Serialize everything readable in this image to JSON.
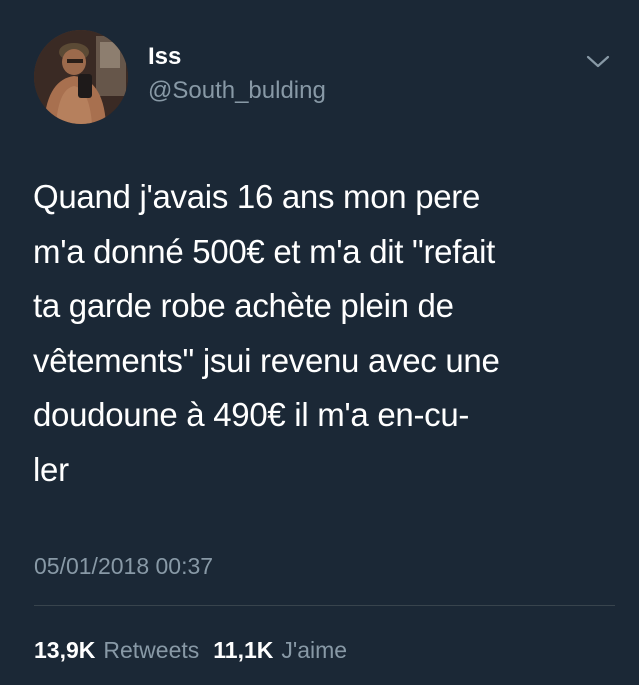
{
  "tweet": {
    "display_name": "Iss",
    "handle": "@South_bulding",
    "text": "Quand j'avais 16 ans mon pere\nm'a donné 500€ et m'a dit \"refait\nta garde robe achète plein de\nvêtements\" jsui revenu avec une\ndoudoune à 490€ il m'a en-cu-\nler",
    "timestamp": "05/01/2018 00:37",
    "retweets_count": "13,9K",
    "retweets_label": "Retweets",
    "likes_count": "11,1K",
    "likes_label": "J'aime"
  },
  "icons": {
    "caret": "chevron-down-icon"
  },
  "colors": {
    "background": "#1b2836",
    "primary_text": "#ffffff",
    "secondary_text": "#8899a6",
    "divider": "#38444d"
  }
}
